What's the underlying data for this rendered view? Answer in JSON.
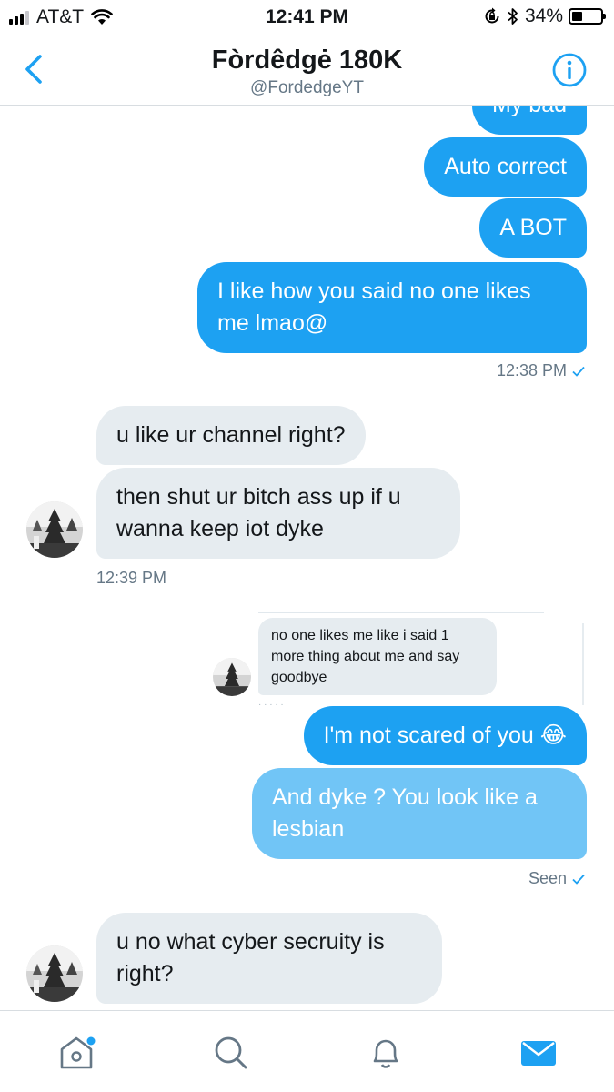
{
  "status_bar": {
    "carrier": "AT&T",
    "time": "12:41 PM",
    "battery_percent": "34%",
    "battery_level": 0.34
  },
  "header": {
    "title": "Fòrdêdgė 180K",
    "handle": "@FordedgeYT"
  },
  "messages": [
    {
      "direction": "outgoing",
      "text": "My bad"
    },
    {
      "direction": "outgoing",
      "text": "Auto correct"
    },
    {
      "direction": "outgoing",
      "text": "A BOT"
    },
    {
      "direction": "outgoing",
      "text": "I like how you said no one likes me lmao@"
    },
    {
      "direction": "incoming",
      "text": "u like ur channel right?"
    },
    {
      "direction": "incoming",
      "text": "then shut ur bitch ass up if u wanna keep iot dyke"
    },
    {
      "direction": "outgoing",
      "text": "I'm not scared of you 😂"
    },
    {
      "direction": "outgoing",
      "text": "And dyke ? You look like a lesbian"
    },
    {
      "direction": "incoming",
      "text": "u no what cyber secruity is right?"
    }
  ],
  "timestamps": {
    "outgoing_1": "12:38 PM",
    "incoming_1": "12:39 PM",
    "seen": "Seen"
  },
  "embedded_screenshot": {
    "text": "no one likes me like i said 1 more thing about me and say goodbye"
  },
  "tabs": [
    {
      "icon": "home-icon",
      "has_notification_dot": true
    },
    {
      "icon": "search-icon"
    },
    {
      "icon": "bell-icon"
    },
    {
      "icon": "mail-icon",
      "active": true
    }
  ],
  "colors": {
    "accent": "#1da1f2",
    "outgoing_bubble": "#1da1f2",
    "outgoing_pending_bubble": "#71c5f6",
    "incoming_bubble": "#e6ecf0",
    "meta_text": "#657786"
  }
}
